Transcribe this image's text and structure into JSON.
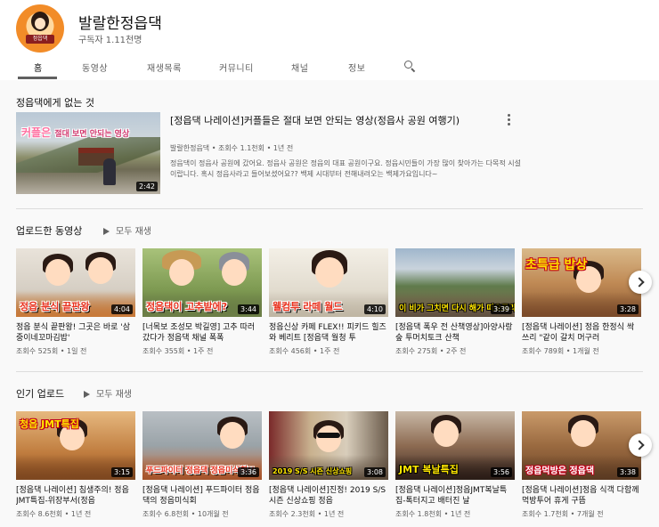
{
  "channel": {
    "name": "발랄한정읍댁",
    "subscribers": "구독자 1.11천명",
    "avatar_label": "정읍댁"
  },
  "tabs": [
    "홈",
    "동영상",
    "재생목록",
    "커뮤니티",
    "채널",
    "정보"
  ],
  "featured": {
    "section_title": "정읍댁에게 없는 것",
    "title": "[정읍댁 나레이션]커플들은 절대 보면 안되는 영상(정읍사 공원 여행기)",
    "meta": "발랄한정읍댁 • 조회수 1.1천회 • 1년 전",
    "description": "정읍댁이 정읍사 공원에 갔어요. 정읍사 공원은 정읍의 대표 공원이구요. 정읍시민들이 가장 많이 찾아가는 다목적 시설이랍니다. 혹시 정읍사라고 들어보셨어요?? 백제 시대부터 전해내려오는 백제가요입니다~",
    "duration": "2:42",
    "thumb_caption": "커플은",
    "thumb_caption_small": "절대 보면 안되는 영상"
  },
  "uploads": {
    "title": "업로드한 동영상",
    "play_all": "모두 재생",
    "videos": [
      {
        "thumb_text": "정읍 분식 끝판왕",
        "duration": "4:04",
        "title": "정읍 분식 끝판왕! 그곳은 바로 '삼중이네꼬마김밥'",
        "meta": "조회수 525회 • 1일 전"
      },
      {
        "thumb_text": "정읍댁이 고추밭에?",
        "duration": "3:44",
        "title": "[너목보 조성모 박길영] 고추 따러 갔다가 정읍댁 채널 폭폭",
        "meta": "조회수 355회 • 1주 전"
      },
      {
        "thumb_text": "웰컴투 라떼 월드",
        "duration": "4:10",
        "title": "정읍신상 카페 FLEX!! 피키드 힐즈와 베리트 [정읍댁 월청 투",
        "meta": "조회수 456회 • 1주 전"
      },
      {
        "thumb_text": "이 비가 그치면 다시 해가 떠오르리라",
        "duration": "3:39",
        "title": "[정읍댁 폭우 전 산책영상]아양사랑숲 투머치토크 산책",
        "meta": "조회수 275회 • 2주 전"
      },
      {
        "thumb_text": "초특급 밥상",
        "duration": "3:28",
        "title": "[정읍댁 나레이션] 정읍 한정식 싹쓰리 \"같이 갈치 머구러",
        "meta": "조회수 789회 • 1개월 전"
      }
    ]
  },
  "popular": {
    "title": "인기 업로드",
    "play_all": "모두 재생",
    "videos": [
      {
        "thumb_text": "청읍 JMT특집",
        "duration": "3:15",
        "title": "[정읍댁 나레이션] 침생주의! 정읍JMT특집-위장부서(정읍",
        "meta": "조회수 8.6천회 • 1년 전"
      },
      {
        "thumb_text": "푸드파이터 정읍댁 정읍미식회!!",
        "duration": "3:36",
        "title": "[정읍댁 나레이션] 푸드파이터 정읍댁의 정읍미식회",
        "meta": "조회수 6.8천회 • 10개월 전"
      },
      {
        "thumb_text": "2019 S/S 시즌 신상쇼핑",
        "duration": "3:08",
        "title": "[정읍댁 나레이션]진정! 2019 S/S시즌 신상쇼핑 정읍",
        "meta": "조회수 2.3천회 • 1년 전"
      },
      {
        "thumb_text": "JMT 복날특집",
        "duration": "3:56",
        "title": "[정읍댁 나레이션]정읍JMT복날특집-톡터지고 배터진 날",
        "meta": "조회수 1.8천회 • 1년 전"
      },
      {
        "thumb_text": "정읍먹방은 정읍댁",
        "duration": "3:38",
        "title": "[정읍댁 나레이션]정읍 식객 다함께 먹방투어 휴게 구뜸",
        "meta": "조회수 1.7천회 • 7개월 전"
      }
    ]
  },
  "colors": {
    "accent_red": "#e8301c",
    "thumb_text_yellow": "#ffe600"
  }
}
